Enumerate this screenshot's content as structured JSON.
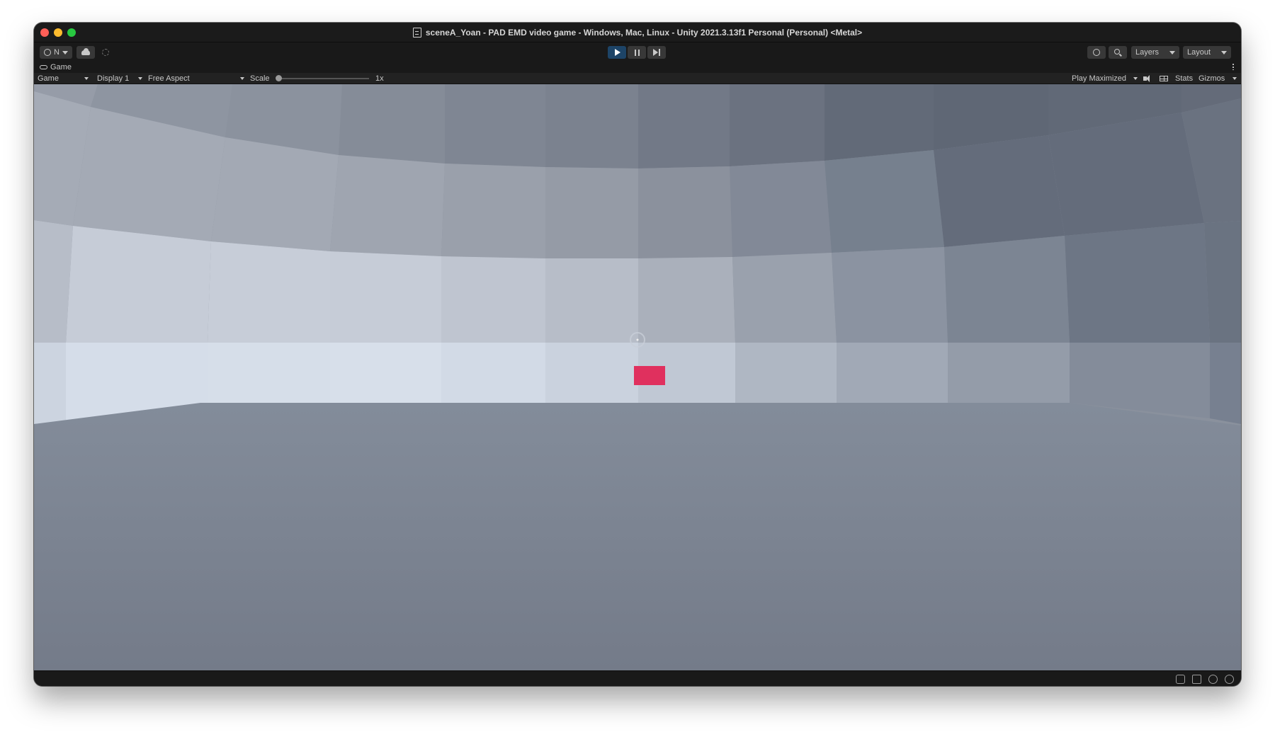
{
  "window": {
    "title": "sceneA_Yoan - PAD EMD video game - Windows, Mac, Linux - Unity 2021.3.13f1 Personal (Personal) <Metal>"
  },
  "toolbar": {
    "account_label": "N",
    "layers_label": "Layers",
    "layout_label": "Layout",
    "play_active": true
  },
  "tab": {
    "label": "Game"
  },
  "game_toolbar": {
    "view_mode": "Game",
    "display": "Display 1",
    "aspect": "Free Aspect",
    "scale_label": "Scale",
    "scale_value": "1x",
    "play_mode": "Play Maximized",
    "stats_label": "Stats",
    "gizmos_label": "Gizmos"
  },
  "scene": {
    "target_color": "#e0305e",
    "floor_color": "#7f8898",
    "wall_light_color": "#d5dde9",
    "ceiling_dark_color": "#5f6775"
  },
  "colors": {
    "play_button_active": "#1d4467",
    "window_chrome": "#191919"
  }
}
